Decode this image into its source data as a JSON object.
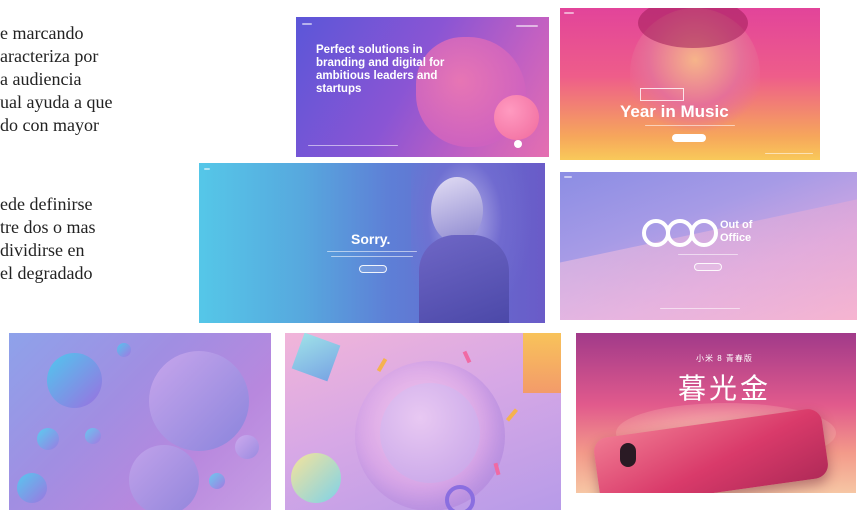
{
  "paragraph_1": [
    "e marcando",
    "aracteriza por",
    "a audiencia",
    "ual ayuda a que",
    "do con mayor"
  ],
  "paragraph_2": [
    "ede definirse",
    "tre dos o mas",
    "dividirse en",
    "el degradado"
  ],
  "gallery": {
    "branding": {
      "headline": "Perfect solutions in branding and digital for ambitious leaders and startups"
    },
    "music": {
      "title": "Year in Music"
    },
    "sorry": {
      "title": "Sorry."
    },
    "office": {
      "title_1": "Out of",
      "title_2": "Office"
    },
    "phone": {
      "subtitle": "小米 8 青春版",
      "title": "暮光金"
    }
  },
  "colors": {
    "text": "#222222",
    "purple": "#7a4fd8",
    "pink": "#f45aa8",
    "cyan": "#52c8e6"
  }
}
